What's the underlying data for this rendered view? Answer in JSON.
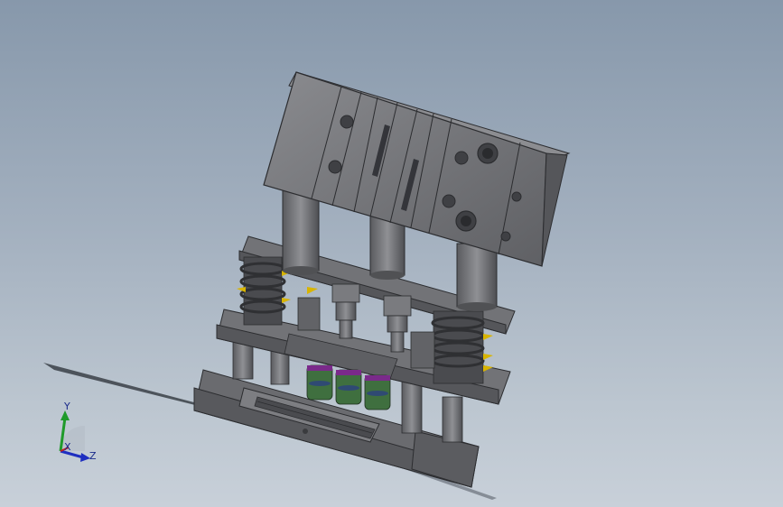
{
  "viewport": {
    "background_top": "#8798ab",
    "background_bottom": "#c8d0d9"
  },
  "model": {
    "body_color": "#6e6f73",
    "dark_color": "#3d3e42",
    "spring_accent": "#d8b400",
    "insert_color": "#3f6f3f",
    "insert_band_color": "#7a2a8a"
  },
  "triad": {
    "y_label": "Y",
    "z_label": "Z",
    "x_label": "X",
    "y_color": "#1f9a2a",
    "z_color": "#1f2fc0",
    "x_color": "#c02020"
  }
}
